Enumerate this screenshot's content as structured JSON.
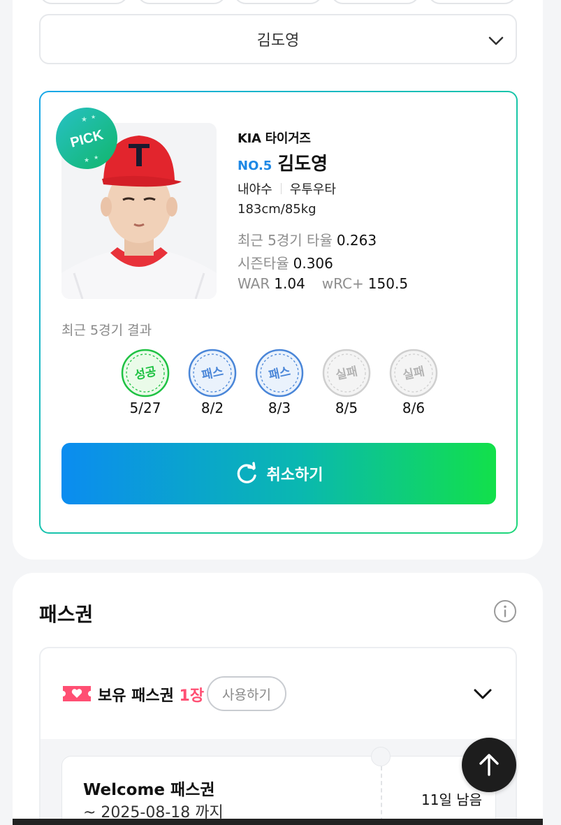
{
  "player_select": {
    "value": "김도영"
  },
  "player": {
    "pick_label": "PICK",
    "team": "KIA 타이거즈",
    "number": "NO.5",
    "name": "김도영",
    "position": "내야수",
    "hand": "우투우타",
    "body": "183cm/85kg",
    "stats": {
      "recent_avg_label": "최근 5경기 타율",
      "recent_avg": "0.263",
      "season_avg_label": "시즌타율",
      "season_avg": "0.306",
      "war_label": "WAR",
      "war": "1.04",
      "wrc_label": "wRC+",
      "wrc": "150.5"
    }
  },
  "recent_results": {
    "label": "최근 5경기 결과",
    "items": [
      {
        "result": "성공",
        "date": "5/27",
        "status": "success",
        "color": "#1fc243"
      },
      {
        "result": "패스",
        "date": "8/2",
        "status": "pass",
        "color": "#4a86d8"
      },
      {
        "result": "패스",
        "date": "8/3",
        "status": "pass",
        "color": "#4a86d8"
      },
      {
        "result": "실패",
        "date": "8/5",
        "status": "fail",
        "color": "#b3b3b3"
      },
      {
        "result": "실패",
        "date": "8/6",
        "status": "fail",
        "color": "#b3b3b3"
      }
    ]
  },
  "cancel_button": {
    "label": "취소하기",
    "icon": "refresh-icon"
  },
  "pass": {
    "title": "패스권",
    "owned_label": "보유 패스권",
    "owned_count": "1장",
    "use_label": "사용하기",
    "tickets": [
      {
        "name": "Welcome 패스권",
        "expiry": "~ 2025-08-18 까지",
        "days_left": "11일 남음"
      }
    ]
  },
  "colors": {
    "accent_blue": "#1e88e5",
    "gradient_start": "#0b8cf0",
    "gradient_end": "#12e04a",
    "ticket_pink": "#ff4f73"
  }
}
